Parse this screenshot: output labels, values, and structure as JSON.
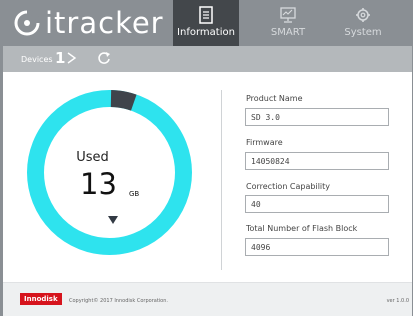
{
  "header": {
    "app_name": "itracker",
    "tabs": [
      {
        "label": "Information",
        "active": true,
        "icon": "document-icon"
      },
      {
        "label": "SMART",
        "active": false,
        "icon": "monitor-icon"
      },
      {
        "label": "System",
        "active": false,
        "icon": "gear-icon"
      }
    ]
  },
  "device_bar": {
    "label": "Devices",
    "count": "1"
  },
  "gauge": {
    "label": "Used",
    "value": "13",
    "unit": "GB",
    "used_fraction": 0.05,
    "ring_color": "#2ee3ee",
    "used_color": "#3f444b"
  },
  "info": {
    "fields": [
      {
        "label": "Product Name",
        "value": "SD 3.0"
      },
      {
        "label": "Firmware",
        "value": "14050824"
      },
      {
        "label": "Correction Capability",
        "value": "40"
      },
      {
        "label": "Total Number of Flash Block",
        "value": "4096"
      }
    ]
  },
  "footer": {
    "brand": "Innodisk",
    "copyright": "Copyright© 2017 Innodisk Corporation.",
    "version": "ver 1.0.0"
  },
  "colors": {
    "header_bg": "#8a8f94",
    "active_tab_bg": "#43474b",
    "device_bar_bg": "#b4b8bb",
    "brand_red": "#d6141d"
  }
}
